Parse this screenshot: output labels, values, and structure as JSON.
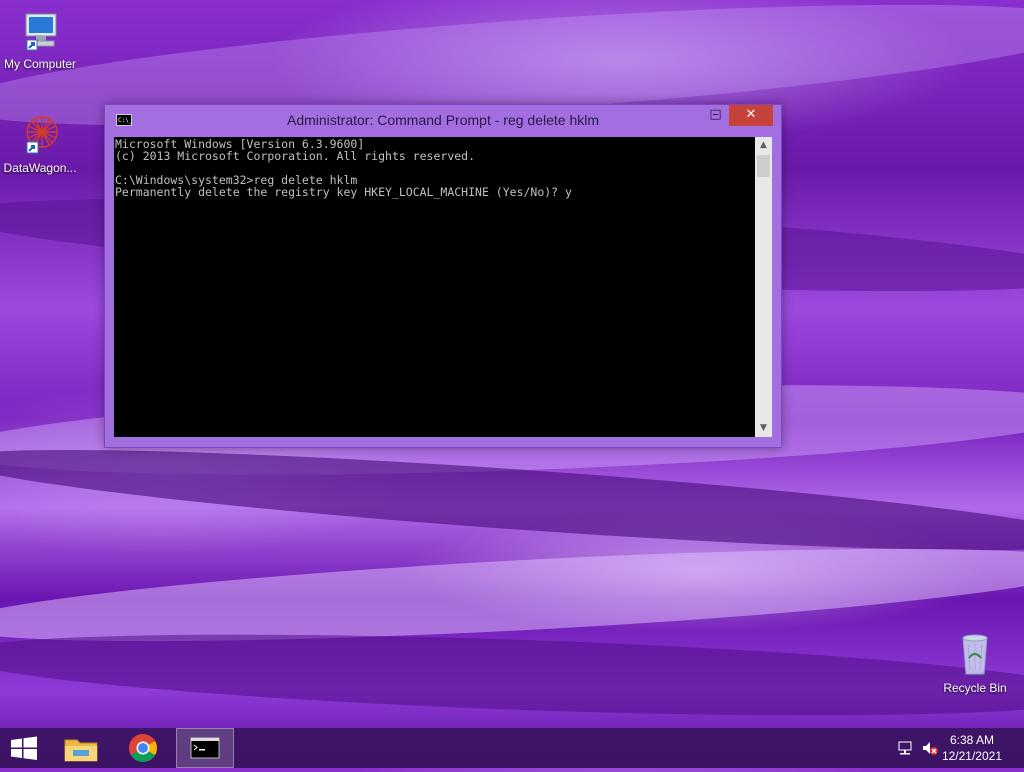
{
  "desktop": {
    "icons": [
      {
        "label": "My Computer",
        "icon": "computer-icon"
      },
      {
        "label": "DataWagon...",
        "icon": "datawagon-icon"
      },
      {
        "label": "Recycle Bin",
        "icon": "recycle-bin-icon"
      }
    ]
  },
  "window": {
    "title": "Administrator: Command Prompt - reg  delete hklm",
    "icon_text": "C:\\_",
    "buttons": {
      "minimize": "–",
      "maximize": "□",
      "close": "✕"
    },
    "console_lines": [
      "Microsoft Windows [Version 6.3.9600]",
      "(c) 2013 Microsoft Corporation. All rights reserved.",
      "",
      "C:\\Windows\\system32>reg delete hklm",
      "Permanently delete the registry key HKEY_LOCAL_MACHINE (Yes/No)? y"
    ],
    "scroll": {
      "up": "▲",
      "down": "▼"
    }
  },
  "taskbar": {
    "items": [
      {
        "name": "start-button",
        "icon": "windows-logo-icon"
      },
      {
        "name": "file-explorer",
        "icon": "folder-icon"
      },
      {
        "name": "chrome",
        "icon": "chrome-icon"
      },
      {
        "name": "command-prompt",
        "icon": "cmd-icon"
      }
    ],
    "clock": {
      "time": "6:38 AM",
      "date": "12/21/2021"
    }
  },
  "colors": {
    "accent": "#a36fe0",
    "close": "#c7423b",
    "console_bg": "#000000",
    "console_fg": "#c0c0c0"
  }
}
